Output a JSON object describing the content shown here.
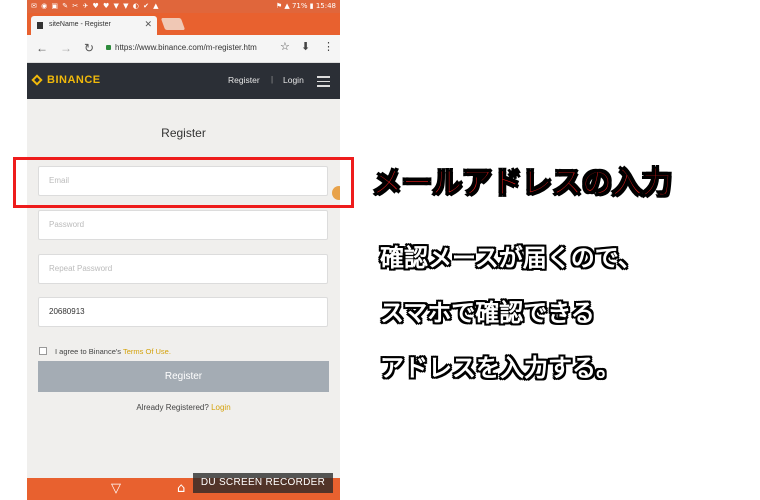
{
  "status_bar": {
    "battery": "71%",
    "time": "15:48"
  },
  "browser": {
    "tab_title": "siteName - Register",
    "url": "https://www.binance.com/m-register.htm"
  },
  "site_header": {
    "logo_text": "BINANCE",
    "register_link": "Register",
    "separator": "|",
    "login_link": "Login"
  },
  "form": {
    "title": "Register",
    "email_placeholder": "Email",
    "password_placeholder": "Password",
    "repeat_password_placeholder": "Repeat Password",
    "captcha_value": "20680913",
    "agree_text": "I agree to Binance's",
    "terms_link": "Terms Of Use.",
    "register_button": "Register",
    "already_text": "Already Registered?",
    "login_link": "Login"
  },
  "recorder_watermark": "DU SCREEN RECORDER",
  "annotation": {
    "title": "メールアドレスの入力",
    "lines": [
      "確認メースが届くので、",
      "スマホで確認できる",
      "アドレスを入力する。"
    ]
  },
  "colors": {
    "highlight_box": "#ee1c1c",
    "brand": "#f0b90b",
    "android_bar": "#e8612f"
  }
}
